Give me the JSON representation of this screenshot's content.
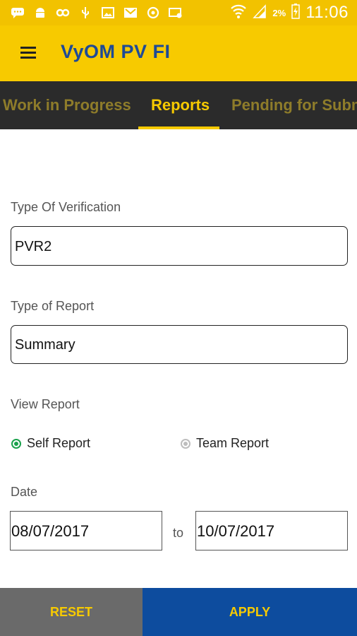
{
  "status_bar": {
    "icons": [
      "chat-icon",
      "android-icon",
      "link-icon",
      "usb-icon",
      "image-icon",
      "gmail-icon",
      "sync-icon",
      "mail-icon"
    ],
    "battery_percent": "2%",
    "time": "11:06"
  },
  "toolbar": {
    "title": "VyOM PV FI"
  },
  "tabs": [
    {
      "label": "Work in Progress",
      "active": false
    },
    {
      "label": "Reports",
      "active": true
    },
    {
      "label": "Pending for Subm",
      "active": false
    }
  ],
  "form": {
    "verification_label": "Type Of Verification",
    "verification_value": "PVR2",
    "report_type_label": "Type of Report",
    "report_type_value": "Summary",
    "view_report_label": "View Report",
    "view_options": [
      {
        "label": "Self Report",
        "selected": true
      },
      {
        "label": "Team Report",
        "selected": false
      }
    ],
    "date_label": "Date",
    "date_from": "08/07/2017",
    "date_separator": "to",
    "date_to": "10/07/2017"
  },
  "actions": {
    "reset_label": "RESET",
    "apply_label": "APPLY"
  },
  "colors": {
    "brand_yellow": "#f7ca00",
    "brand_blue": "#0d4c9e",
    "tab_bar": "#2b2b2b",
    "radio_selected": "#1aa14c"
  }
}
